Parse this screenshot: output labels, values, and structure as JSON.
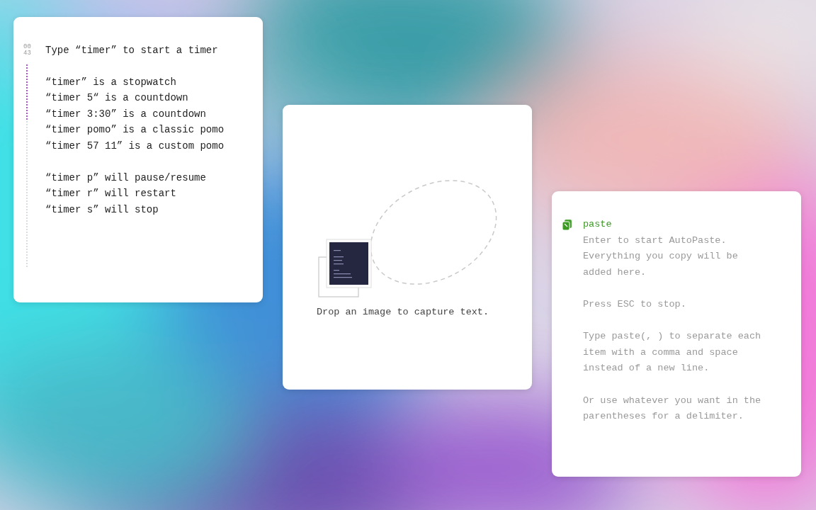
{
  "timer_card": {
    "clock": [
      "00",
      "43"
    ],
    "progress": {
      "level": 0.28
    },
    "title": "Type “timer” to start a timer",
    "examples": [
      "“timer” is a stopwatch",
      "“timer 5“ is a countdown",
      "“timer 3:30” is a countdown",
      "“timer pomo” is a classic pomo",
      "“timer 57 11” is a custom pomo"
    ],
    "controls": [
      "“timer p” will pause/resume",
      "“timer r” will restart",
      "“timer s” will stop"
    ]
  },
  "capture_card": {
    "hint": "Drop an image to capture text."
  },
  "paste_card": {
    "command": "paste",
    "paragraphs": [
      "Enter to start AutoPaste. Everything you copy will be added here.",
      "Press ESC to stop.",
      "Type paste(, ) to separate each item with a comma and space instead of a new line.",
      "Or use whatever you want in the parentheses for a delimiter."
    ]
  }
}
